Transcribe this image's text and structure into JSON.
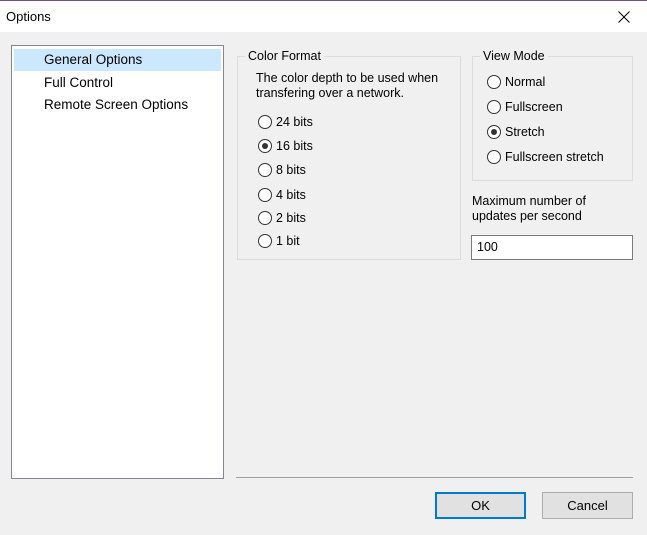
{
  "window": {
    "title": "Options"
  },
  "nav": {
    "items": [
      {
        "label": "General Options",
        "selected": true
      },
      {
        "label": "Full Control",
        "selected": false
      },
      {
        "label": "Remote Screen Options",
        "selected": false
      }
    ]
  },
  "color_format": {
    "legend": "Color Format",
    "description_line1": "The color depth to be used when",
    "description_line2": "transfering over a network.",
    "options": [
      {
        "label": "24 bits",
        "checked": false
      },
      {
        "label": "16 bits",
        "checked": true
      },
      {
        "label": "8 bits",
        "checked": false
      },
      {
        "label": "4 bits",
        "checked": false
      },
      {
        "label": "2 bits",
        "checked": false
      },
      {
        "label": "1 bit",
        "checked": false
      }
    ]
  },
  "view_mode": {
    "legend": "View Mode",
    "options": [
      {
        "label": "Normal",
        "checked": false
      },
      {
        "label": "Fullscreen",
        "checked": false
      },
      {
        "label": "Stretch",
        "checked": true
      },
      {
        "label": "Fullscreen stretch",
        "checked": false
      }
    ]
  },
  "max_updates": {
    "label_line1": "Maximum number of",
    "label_line2": "updates per second",
    "value": "100"
  },
  "buttons": {
    "ok": "OK",
    "cancel": "Cancel"
  },
  "colors": {
    "selection": "#cce8ff",
    "accent": "#0078d7"
  }
}
